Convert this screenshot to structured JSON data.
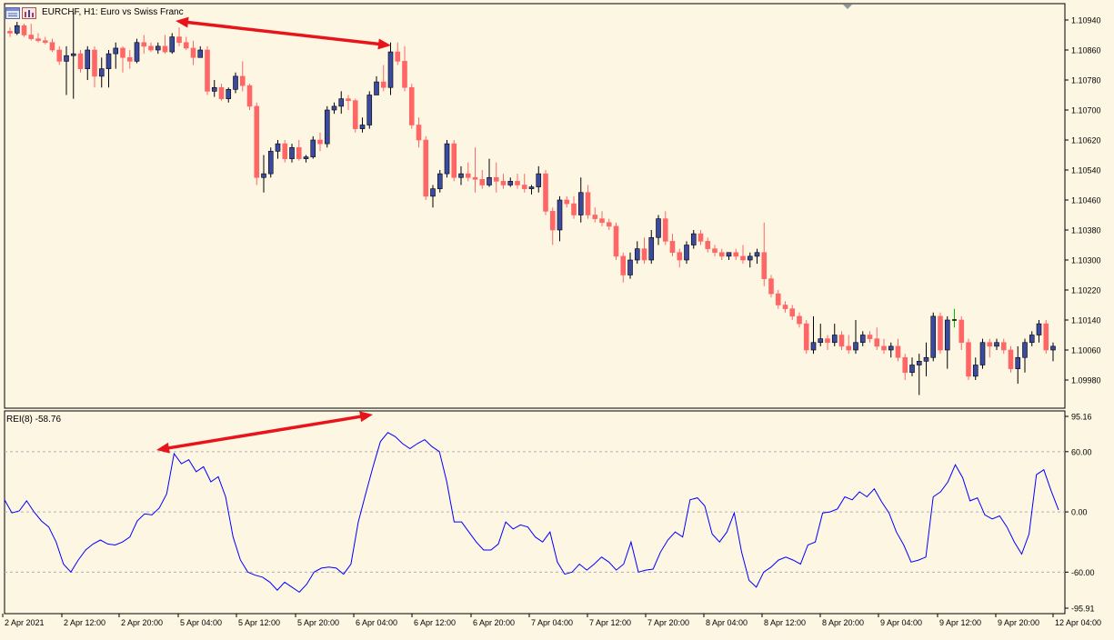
{
  "window": {
    "title": "EURCHF, H1:  Euro vs Swiss Franc",
    "icons": [
      "chart-window-icon",
      "chart-bars-icon"
    ]
  },
  "colors": {
    "background": "#fdf6e3",
    "bull_candle": "#3b4a9e",
    "bear_candle": "#ff6666",
    "doji_green": "#00bb00",
    "indicator_line": "#0000ff",
    "annotation_arrow": "#e8141b",
    "grid_line": "#b0b0b0"
  },
  "indicator": {
    "label": "REI(8) -58.76"
  },
  "chart_data": [
    {
      "type": "candlestick",
      "symbol": "EURCHF",
      "timeframe": "H1",
      "yticks": [
        "1.10940",
        "1.10860",
        "1.10780",
        "1.10700",
        "1.10620",
        "1.10540",
        "1.10460",
        "1.10380",
        "1.10300",
        "1.10220",
        "1.10140",
        "1.10060",
        "1.09980"
      ],
      "ylim": [
        1.0994,
        1.1098
      ],
      "xticks": [
        "2 Apr 2021",
        "2 Apr 12:00",
        "2 Apr 20:00",
        "5 Apr 04:00",
        "5 Apr 12:00",
        "5 Apr 20:00",
        "6 Apr 04:00",
        "6 Apr 12:00",
        "6 Apr 20:00",
        "7 Apr 04:00",
        "7 Apr 12:00",
        "7 Apr 20:00",
        "8 Apr 04:00",
        "8 Apr 12:00",
        "8 Apr 20:00",
        "9 Apr 04:00",
        "9 Apr 12:00",
        "9 Apr 20:00",
        "12 Apr 04:00"
      ],
      "candles": [
        [
          1.1091,
          1.1092,
          1.10895,
          1.10905
        ],
        [
          1.10905,
          1.10935,
          1.109,
          1.10925
        ],
        [
          1.10925,
          1.1093,
          1.10895,
          1.109
        ],
        [
          1.109,
          1.1093,
          1.10885,
          1.1089
        ],
        [
          1.1089,
          1.10905,
          1.1088,
          1.10885
        ],
        [
          1.10885,
          1.10895,
          1.10875,
          1.1088
        ],
        [
          1.1088,
          1.1089,
          1.10855,
          1.1086
        ],
        [
          1.1086,
          1.1087,
          1.1082,
          1.1083
        ],
        [
          1.1083,
          1.1087,
          1.1074,
          1.10845
        ],
        [
          1.10845,
          1.1096,
          1.1073,
          1.1085
        ],
        [
          1.1085,
          1.1086,
          1.108,
          1.1081
        ],
        [
          1.1081,
          1.1087,
          1.1078,
          1.1086
        ],
        [
          1.1086,
          1.1087,
          1.1076,
          1.1079
        ],
        [
          1.1079,
          1.1084,
          1.1076,
          1.1081
        ],
        [
          1.1081,
          1.1086,
          1.1076,
          1.1085
        ],
        [
          1.1085,
          1.1088,
          1.1081,
          1.10865
        ],
        [
          1.10865,
          1.1087,
          1.108,
          1.1084
        ],
        [
          1.1084,
          1.1086,
          1.1081,
          1.1083
        ],
        [
          1.1083,
          1.1089,
          1.10825,
          1.1088
        ],
        [
          1.1088,
          1.109,
          1.1085,
          1.1087
        ],
        [
          1.1087,
          1.1088,
          1.10855,
          1.1086
        ],
        [
          1.1086,
          1.1088,
          1.1085,
          1.1087
        ],
        [
          1.1087,
          1.109,
          1.1085,
          1.10855
        ],
        [
          1.10855,
          1.10905,
          1.1085,
          1.10895
        ],
        [
          1.10895,
          1.1092,
          1.1087,
          1.1088
        ],
        [
          1.1088,
          1.10895,
          1.1086,
          1.10865
        ],
        [
          1.10865,
          1.10885,
          1.1082,
          1.1084
        ],
        [
          1.1084,
          1.1087,
          1.1084,
          1.1086
        ],
        [
          1.1086,
          1.1087,
          1.1074,
          1.1075
        ],
        [
          1.1075,
          1.1078,
          1.10735,
          1.1076
        ],
        [
          1.1076,
          1.1077,
          1.10725,
          1.1073
        ],
        [
          1.1073,
          1.1076,
          1.1072,
          1.10755
        ],
        [
          1.10755,
          1.108,
          1.10745,
          1.1079
        ],
        [
          1.1079,
          1.1083,
          1.1075,
          1.10765
        ],
        [
          1.10765,
          1.1077,
          1.107,
          1.1071
        ],
        [
          1.1071,
          1.1072,
          1.105,
          1.1052
        ],
        [
          1.1052,
          1.1058,
          1.1048,
          1.1053
        ],
        [
          1.1053,
          1.106,
          1.1052,
          1.1059
        ],
        [
          1.1059,
          1.1062,
          1.1057,
          1.1061
        ],
        [
          1.1061,
          1.1062,
          1.1056,
          1.1057
        ],
        [
          1.1057,
          1.1061,
          1.1056,
          1.106
        ],
        [
          1.106,
          1.1062,
          1.10565,
          1.1057
        ],
        [
          1.1057,
          1.1058,
          1.1056,
          1.10575
        ],
        [
          1.10575,
          1.1063,
          1.1057,
          1.1062
        ],
        [
          1.1062,
          1.1064,
          1.1059,
          1.1061
        ],
        [
          1.1061,
          1.1071,
          1.106,
          1.107
        ],
        [
          1.107,
          1.1072,
          1.1069,
          1.1071
        ],
        [
          1.1071,
          1.1075,
          1.1069,
          1.1073
        ],
        [
          1.1073,
          1.1074,
          1.107,
          1.10725
        ],
        [
          1.10725,
          1.1073,
          1.1064,
          1.1065
        ],
        [
          1.1065,
          1.1068,
          1.1064,
          1.1066
        ],
        [
          1.1066,
          1.1075,
          1.1065,
          1.1074
        ],
        [
          1.1074,
          1.1079,
          1.1074,
          1.10775
        ],
        [
          1.10775,
          1.1082,
          1.1075,
          1.1076
        ],
        [
          1.1076,
          1.1088,
          1.1074,
          1.10855
        ],
        [
          1.10855,
          1.1088,
          1.1082,
          1.1083
        ],
        [
          1.1083,
          1.1087,
          1.1075,
          1.1076
        ],
        [
          1.1076,
          1.1077,
          1.1065,
          1.1066
        ],
        [
          1.1066,
          1.1068,
          1.106,
          1.1062
        ],
        [
          1.1062,
          1.1063,
          1.1046,
          1.1047
        ],
        [
          1.1047,
          1.105,
          1.1044,
          1.1049
        ],
        [
          1.1049,
          1.1054,
          1.1048,
          1.1053
        ],
        [
          1.1053,
          1.1062,
          1.1052,
          1.1061
        ],
        [
          1.1061,
          1.1062,
          1.1051,
          1.1052
        ],
        [
          1.1052,
          1.1055,
          1.105,
          1.1053
        ],
        [
          1.1053,
          1.1056,
          1.1051,
          1.1052
        ],
        [
          1.1052,
          1.106,
          1.1048,
          1.10515
        ],
        [
          1.10515,
          1.1054,
          1.1049,
          1.105
        ],
        [
          1.105,
          1.1057,
          1.10495,
          1.1052
        ],
        [
          1.1052,
          1.1056,
          1.1048,
          1.1051
        ],
        [
          1.1051,
          1.1053,
          1.1049,
          1.105
        ],
        [
          1.105,
          1.1052,
          1.10495,
          1.1051
        ],
        [
          1.1051,
          1.1053,
          1.1049,
          1.105
        ],
        [
          1.105,
          1.1053,
          1.1048,
          1.1049
        ],
        [
          1.1049,
          1.105,
          1.10475,
          1.10495
        ],
        [
          1.10495,
          1.1055,
          1.1048,
          1.1053
        ],
        [
          1.1053,
          1.1054,
          1.1042,
          1.1043
        ],
        [
          1.1043,
          1.1044,
          1.1034,
          1.1038
        ],
        [
          1.1038,
          1.1047,
          1.1035,
          1.1046
        ],
        [
          1.1046,
          1.1047,
          1.1044,
          1.1045
        ],
        [
          1.1045,
          1.1047,
          1.1041,
          1.1042
        ],
        [
          1.1042,
          1.1052,
          1.104,
          1.1048
        ],
        [
          1.1048,
          1.105,
          1.1041,
          1.1042
        ],
        [
          1.1042,
          1.1044,
          1.104,
          1.1041
        ],
        [
          1.1041,
          1.1043,
          1.1039,
          1.104
        ],
        [
          1.104,
          1.1041,
          1.1038,
          1.1039
        ],
        [
          1.1039,
          1.104,
          1.103,
          1.1031
        ],
        [
          1.1031,
          1.1032,
          1.1024,
          1.1026
        ],
        [
          1.1026,
          1.1032,
          1.1025,
          1.103
        ],
        [
          1.103,
          1.1035,
          1.1029,
          1.1033
        ],
        [
          1.1033,
          1.1036,
          1.1029,
          1.103
        ],
        [
          1.103,
          1.1038,
          1.1029,
          1.1036
        ],
        [
          1.1036,
          1.1042,
          1.1034,
          1.1041
        ],
        [
          1.1041,
          1.1043,
          1.1034,
          1.1035
        ],
        [
          1.1035,
          1.1037,
          1.1031,
          1.1032
        ],
        [
          1.1032,
          1.1033,
          1.1028,
          1.103
        ],
        [
          1.103,
          1.1035,
          1.1029,
          1.1034
        ],
        [
          1.1034,
          1.1038,
          1.1033,
          1.1037
        ],
        [
          1.1037,
          1.1038,
          1.1034,
          1.1035
        ],
        [
          1.1035,
          1.1036,
          1.1032,
          1.1033
        ],
        [
          1.1033,
          1.1034,
          1.1031,
          1.1032
        ],
        [
          1.1032,
          1.1033,
          1.103,
          1.1031
        ],
        [
          1.1031,
          1.1032,
          1.103,
          1.1032
        ],
        [
          1.1032,
          1.1033,
          1.103,
          1.1031
        ],
        [
          1.1031,
          1.1034,
          1.1029,
          1.103
        ],
        [
          1.103,
          1.1032,
          1.1028,
          1.1031
        ],
        [
          1.1031,
          1.1033,
          1.1029,
          1.1032
        ],
        [
          1.1032,
          1.104,
          1.1023,
          1.1025
        ],
        [
          1.1025,
          1.1026,
          1.102,
          1.1021
        ],
        [
          1.1021,
          1.1022,
          1.1017,
          1.1018
        ],
        [
          1.1018,
          1.1019,
          1.1016,
          1.1017
        ],
        [
          1.1017,
          1.1018,
          1.1014,
          1.1015
        ],
        [
          1.1015,
          1.1016,
          1.1012,
          1.1013
        ],
        [
          1.1013,
          1.1014,
          1.1005,
          1.1006
        ],
        [
          1.1006,
          1.1015,
          1.1005,
          1.1008
        ],
        [
          1.1008,
          1.1013,
          1.1007,
          1.1009
        ],
        [
          1.1009,
          1.101,
          1.1006,
          1.1008
        ],
        [
          1.1008,
          1.1013,
          1.1007,
          1.101
        ],
        [
          1.101,
          1.1011,
          1.1006,
          1.1007
        ],
        [
          1.1007,
          1.101,
          1.1005,
          1.1006
        ],
        [
          1.1006,
          1.1014,
          1.1005,
          1.1008
        ],
        [
          1.1008,
          1.1011,
          1.1007,
          1.101
        ],
        [
          1.101,
          1.1011,
          1.1008,
          1.1009
        ],
        [
          1.1009,
          1.1012,
          1.1006,
          1.1007
        ],
        [
          1.1007,
          1.1009,
          1.1005,
          1.1006
        ],
        [
          1.1006,
          1.1008,
          1.1004,
          1.1007
        ],
        [
          1.1007,
          1.1009,
          1.1003,
          1.1004
        ],
        [
          1.1004,
          1.1005,
          1.0998,
          1.1
        ],
        [
          1.1,
          1.1004,
          1.0999,
          1.1002
        ],
        [
          1.1002,
          1.1005,
          1.0994,
          1.1003
        ],
        [
          1.1003,
          1.1008,
          1.0999,
          1.1004
        ],
        [
          1.1004,
          1.1016,
          1.1003,
          1.1015
        ],
        [
          1.1015,
          1.1016,
          1.1005,
          1.1006
        ],
        [
          1.1006,
          1.1015,
          1.1001,
          1.1014
        ],
        [
          1.1014,
          1.1017,
          1.1012,
          1.1014
        ],
        [
          1.1014,
          1.1015,
          1.1006,
          1.1008
        ],
        [
          1.1008,
          1.1009,
          1.0998,
          1.0999
        ],
        [
          1.0999,
          1.1004,
          1.0998,
          1.1002
        ],
        [
          1.1002,
          1.1009,
          1.1001,
          1.1008
        ],
        [
          1.1008,
          1.1009,
          1.1004,
          1.1007
        ],
        [
          1.1007,
          1.1009,
          1.1006,
          1.1008
        ],
        [
          1.1008,
          1.1009,
          1.1005,
          1.1006
        ],
        [
          1.1006,
          1.1007,
          1.1,
          1.1001
        ],
        [
          1.1001,
          1.1007,
          1.0997,
          1.1004
        ],
        [
          1.1004,
          1.1009,
          1.1,
          1.1008
        ],
        [
          1.1008,
          1.1011,
          1.1007,
          1.101
        ],
        [
          1.101,
          1.1014,
          1.1008,
          1.1013
        ],
        [
          1.1013,
          1.1014,
          1.1005,
          1.1006
        ],
        [
          1.1006,
          1.1008,
          1.1003,
          1.1007
        ]
      ]
    },
    {
      "type": "line",
      "name": "REI(8)",
      "yticks": [
        "95.16",
        "60.00",
        "0.00",
        "-60.00",
        "-95.91"
      ],
      "ylim": [
        -95.91,
        95.16
      ],
      "levels": [
        60,
        0,
        -60
      ],
      "values": [
        12,
        -1,
        1,
        11,
        0,
        -9,
        -15,
        -30,
        -52,
        -60,
        -48,
        -38,
        -32,
        -28,
        -32,
        -33,
        -30,
        -25,
        -9,
        -2,
        -3,
        4,
        18,
        58,
        48,
        52,
        40,
        45,
        30,
        35,
        15,
        -25,
        -48,
        -60,
        -63,
        -65,
        -70,
        -78,
        -70,
        -75,
        -80,
        -72,
        -60,
        -56,
        -55,
        -56,
        -62,
        -52,
        -10,
        18,
        45,
        70,
        79,
        75,
        68,
        63,
        68,
        72,
        65,
        60,
        30,
        -10,
        -10,
        -20,
        -30,
        -38,
        -38,
        -32,
        -10,
        -17,
        -13,
        -15,
        -25,
        -30,
        -20,
        -50,
        -62,
        -60,
        -52,
        -58,
        -52,
        -45,
        -50,
        -58,
        -52,
        -30,
        -60,
        -58,
        -57,
        -40,
        -28,
        -20,
        -25,
        12,
        14,
        6,
        -22,
        -30,
        -20,
        -1,
        -40,
        -68,
        -75,
        -60,
        -55,
        -48,
        -45,
        -48,
        -52,
        -33,
        -30,
        -1,
        0,
        3,
        15,
        12,
        20,
        15,
        23,
        10,
        -1,
        -20,
        -33,
        -50,
        -48,
        -45,
        15,
        20,
        30,
        47,
        34,
        11,
        14,
        -3,
        -7,
        -4,
        -15,
        -30,
        -42,
        -22,
        37,
        42,
        21,
        2
      ]
    }
  ]
}
